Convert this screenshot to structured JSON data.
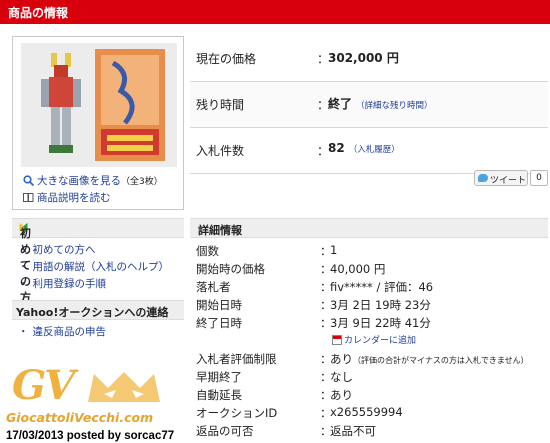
{
  "header": {
    "title": "商品の情報"
  },
  "image_box": {
    "enlarge_link": "大きな画像を見る",
    "enlarge_count": "（全3枚）",
    "description_link": "商品説明を読む"
  },
  "price": {
    "current_label": "現在の価格",
    "current_value": "302,000 円",
    "remaining_label": "残り時間",
    "remaining_value": "終了",
    "remaining_link": "（詳細な残り時間）",
    "bids_label": "入札件数",
    "bids_value": "82",
    "bids_link": "（入札履歴）",
    "colon": "："
  },
  "tweet": {
    "label": "ツイート",
    "count": "0"
  },
  "sidebar": {
    "beginner_title": "初めての方",
    "beginner_links": [
      "初めての方へ",
      "用語の解説（入札のヘルプ）",
      "利用登録の手順"
    ],
    "contact_title": "Yahoo!オークションへの連絡",
    "contact_links": [
      "違反商品の申告"
    ],
    "bullet": "・"
  },
  "detail": {
    "title": "詳細情報",
    "rows": [
      {
        "label": "個数",
        "value": "1"
      },
      {
        "label": "開始時の価格",
        "value": "40,000 円"
      },
      {
        "label": "落札者",
        "value": "fiv***** / 評価：46"
      },
      {
        "label": "開始日時",
        "value": "3月 2日 19時 23分"
      },
      {
        "label": "終了日時",
        "value": "3月 9日 22時 41分"
      },
      {
        "label": "入札者評価制限",
        "value": "あり",
        "note": "（評価の合計がマイナスの方は入札できません）"
      },
      {
        "label": "早期終了",
        "value": "なし"
      },
      {
        "label": "自動延長",
        "value": "あり"
      },
      {
        "label": "オークションID",
        "value": "x265559994"
      },
      {
        "label": "返品の可否",
        "value": "返品不可"
      }
    ],
    "calendar_link": "カレンダーに追加"
  },
  "watermark": {
    "logo": "GV",
    "site": "GiocattoliVecchi.com",
    "posted": "17/03/2013 posted by sorcac77"
  },
  "colors": {
    "header_red": "#d9000e",
    "link_blue": "#1f3c99",
    "watermark_orange": "#f0b23e"
  }
}
